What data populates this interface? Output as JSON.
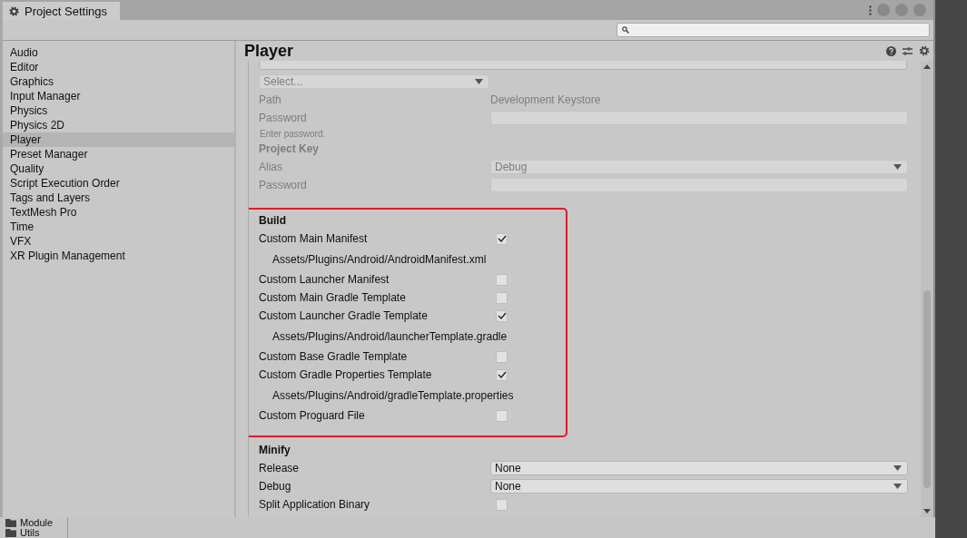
{
  "window": {
    "title": "Project Settings"
  },
  "sidebar": {
    "items": [
      {
        "label": "Audio",
        "selected": false
      },
      {
        "label": "Editor",
        "selected": false
      },
      {
        "label": "Graphics",
        "selected": false
      },
      {
        "label": "Input Manager",
        "selected": false
      },
      {
        "label": "Physics",
        "selected": false
      },
      {
        "label": "Physics 2D",
        "selected": false
      },
      {
        "label": "Player",
        "selected": true
      },
      {
        "label": "Preset Manager",
        "selected": false
      },
      {
        "label": "Quality",
        "selected": false
      },
      {
        "label": "Script Execution Order",
        "selected": false
      },
      {
        "label": "Tags and Layers",
        "selected": false
      },
      {
        "label": "TextMesh Pro",
        "selected": false
      },
      {
        "label": "Time",
        "selected": false
      },
      {
        "label": "VFX",
        "selected": false
      },
      {
        "label": "XR Plugin Management",
        "selected": false
      }
    ]
  },
  "inspector": {
    "title": "Player",
    "sections": [
      {
        "highlighted": false,
        "items": [
          {
            "kind": "dropdown",
            "value": "Select...",
            "disabled": true
          },
          {
            "kind": "value",
            "label": "Path",
            "value": "Development Keystore",
            "disabled": true
          },
          {
            "kind": "input",
            "label": "Password",
            "disabled": true
          },
          {
            "kind": "hint",
            "text": "Enter password.",
            "disabled": true
          },
          {
            "kind": "heading",
            "text": "Project Key",
            "disabled": true
          },
          {
            "kind": "dropdown",
            "label": "Alias",
            "value": "Debug",
            "disabled": true
          },
          {
            "kind": "input",
            "label": "Password",
            "disabled": true
          }
        ]
      },
      {
        "highlighted": true,
        "items": [
          {
            "kind": "heading",
            "text": "Build",
            "disabled": false
          },
          {
            "kind": "checkbox",
            "label": "Custom Main Manifest",
            "checked": true,
            "disabled": false
          },
          {
            "kind": "path",
            "text": "Assets/Plugins/Android/AndroidManifest.xml",
            "disabled": false
          },
          {
            "kind": "checkbox",
            "label": "Custom Launcher Manifest",
            "checked": false,
            "disabled": false
          },
          {
            "kind": "checkbox",
            "label": "Custom Main Gradle Template",
            "checked": false,
            "disabled": false
          },
          {
            "kind": "checkbox",
            "label": "Custom Launcher Gradle Template",
            "checked": true,
            "disabled": false
          },
          {
            "kind": "path",
            "text": "Assets/Plugins/Android/launcherTemplate.gradle",
            "disabled": false
          },
          {
            "kind": "checkbox",
            "label": "Custom Base Gradle Template",
            "checked": false,
            "disabled": false
          },
          {
            "kind": "checkbox",
            "label": "Custom Gradle Properties Template",
            "checked": true,
            "disabled": false
          },
          {
            "kind": "path",
            "text": "Assets/Plugins/Android/gradleTemplate.properties",
            "disabled": false
          },
          {
            "kind": "checkbox",
            "label": "Custom Proguard File",
            "checked": false,
            "disabled": false
          }
        ]
      },
      {
        "highlighted": false,
        "items": [
          {
            "kind": "heading",
            "text": "Minify",
            "disabled": false
          },
          {
            "kind": "dropdown",
            "label": "Release",
            "value": "None",
            "disabled": false
          },
          {
            "kind": "dropdown",
            "label": "Debug",
            "value": "None",
            "disabled": false
          },
          {
            "kind": "checkbox",
            "label": "Split Application Binary",
            "checked": false,
            "disabled": false
          }
        ]
      }
    ]
  },
  "project_browser": {
    "items": [
      "Module",
      "Utils"
    ]
  }
}
